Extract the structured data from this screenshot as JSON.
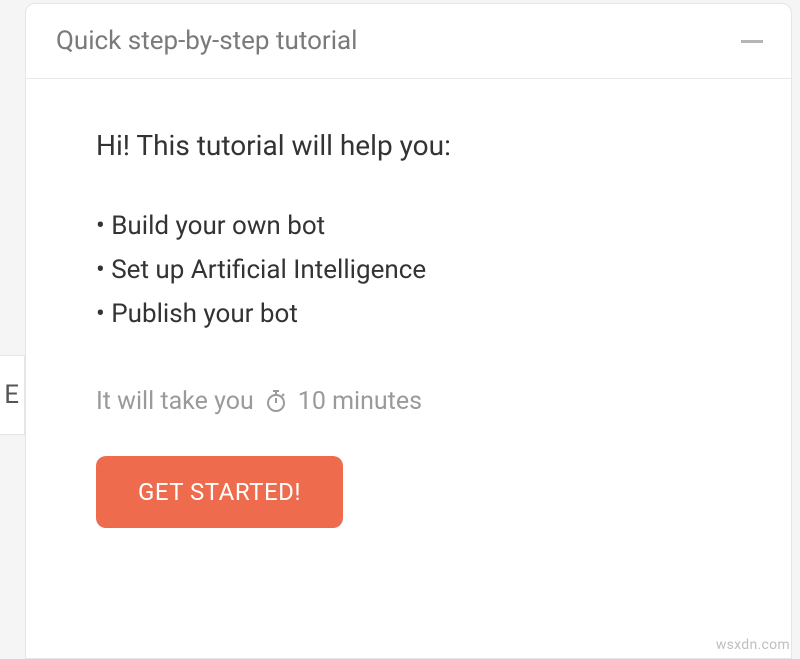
{
  "header": {
    "title": "Quick step-by-step tutorial"
  },
  "body": {
    "intro": "Hi! This tutorial will help you:",
    "bullets": [
      "Build your own bot",
      "Set up Artificial Intelligence",
      "Publish your bot"
    ],
    "time_prefix": "It will take you",
    "time_value": "10 minutes",
    "cta_label": "GET STARTED!"
  },
  "side_text": "E",
  "watermark": "wsxdn.com"
}
